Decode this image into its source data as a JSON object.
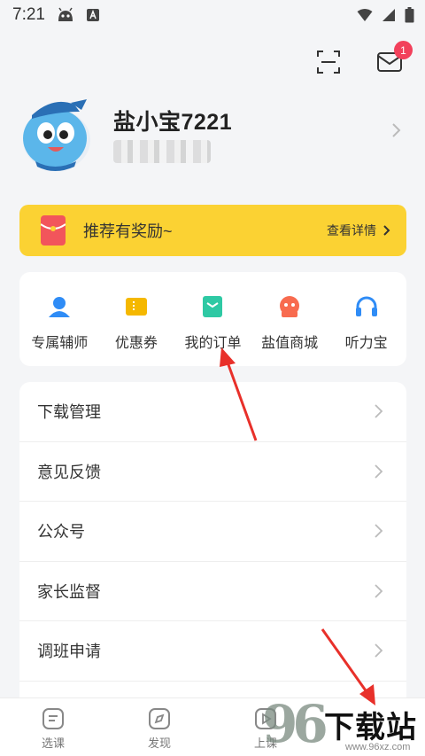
{
  "status_bar": {
    "time": "7:21"
  },
  "top_bar": {
    "message_badge_count": "1"
  },
  "profile": {
    "username": "盐小宝7221"
  },
  "reward_banner": {
    "text": "推荐有奖励~",
    "link_label": "查看详情"
  },
  "quick_actions": [
    {
      "label": "专属辅师",
      "icon": "tutor-icon",
      "color": "#2f8cf6"
    },
    {
      "label": "优惠券",
      "icon": "coupon-icon",
      "color": "#f5b800"
    },
    {
      "label": "我的订单",
      "icon": "order-icon",
      "color": "#2ec9a4"
    },
    {
      "label": "盐值商城",
      "icon": "mall-icon",
      "color": "#f86b4f"
    },
    {
      "label": "听力宝",
      "icon": "headphone-icon",
      "color": "#2f8cf6"
    }
  ],
  "menu_items": [
    {
      "label": "下载管理"
    },
    {
      "label": "意见反馈"
    },
    {
      "label": "公众号"
    },
    {
      "label": "家长监督"
    },
    {
      "label": "调班申请"
    }
  ],
  "tab_bar": [
    {
      "label": "选课",
      "icon": "course-icon"
    },
    {
      "label": "发现",
      "icon": "compass-icon"
    },
    {
      "label": "上课",
      "icon": "play-icon"
    }
  ],
  "watermark": {
    "number": "96",
    "text": "下载站",
    "url": "www.96xz.com"
  },
  "colors": {
    "banner": "#fbd233",
    "badge": "#f2405b",
    "annotation_arrow": "#e8302a"
  }
}
